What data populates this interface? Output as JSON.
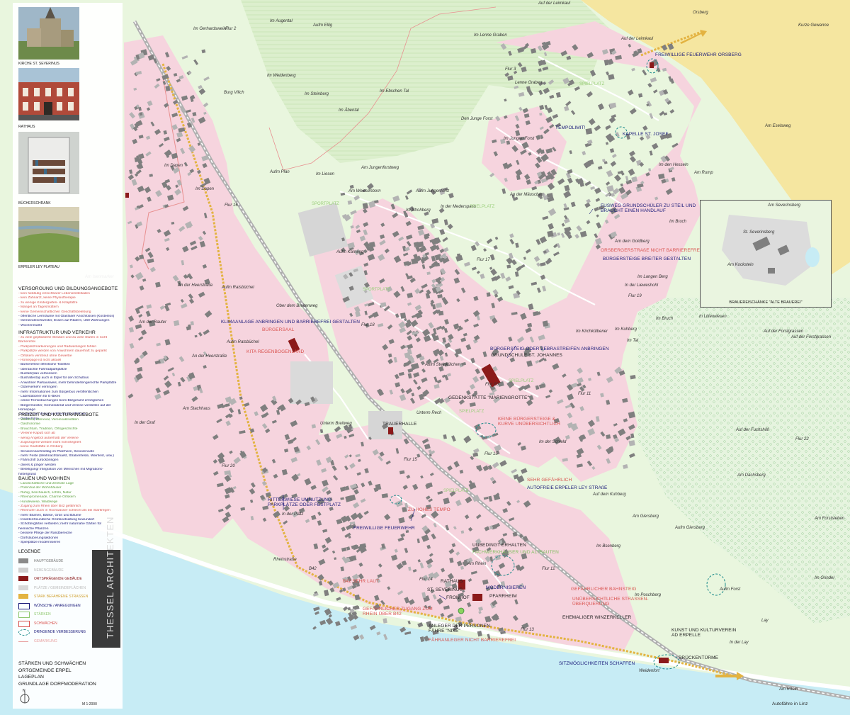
{
  "sidebar": {
    "photos": [
      {
        "caption": "KIRCHE ST. SEVERINUS",
        "color": "#8f8f6a"
      },
      {
        "caption": "RATHAUS",
        "color": "#b04a3a"
      },
      {
        "caption": "BÜCHERSCHRANK",
        "color": "#8a8a82"
      },
      {
        "caption": "ERPELER LEY PLATEAU",
        "color": "#8aa06a"
      }
    ],
    "sections": [
      {
        "title": "VERSORGUNG UND BILDUNGSANGEBOTE",
        "items": [
          {
            "t": "- kein fußläufig erreichbarer Lebensmittelladen",
            "c": "w"
          },
          {
            "t": "- kein Zahnarzt, keine Physiotherapie",
            "c": "w"
          },
          {
            "t": "- zu wenige Kindergarten- & Kitaplätze",
            "c": "w"
          },
          {
            "t": "- Mangel an Tagesmüttern",
            "c": "w"
          },
          {
            "t": "- keine Gemeinschaftlichen Geschäftsbelebung",
            "c": "w"
          },
          {
            "t": "- öffentliche Lernräume mit Glasfaser Anschlüssen (Kostenlos)",
            "c": "v"
          },
          {
            "t": "- Gemeindeschwester, Essen auf Rädern, Ü60 Wohnungen",
            "c": "v"
          },
          {
            "t": "- Wochenmarkt",
            "c": "v"
          }
        ]
      },
      {
        "title": "INFRASTRUKTUR UND VERKEHR",
        "items": [
          {
            "t": "- zu viele gepflasterte Straßen und zu viele Stufen in nicht",
            "c": "w"
          },
          {
            "t": "  Barrierefrei",
            "c": "w"
          },
          {
            "t": "- Parkplatzmarkierungen und Radweitungen fehlen",
            "c": "w"
          },
          {
            "t": "- Parkplätze werden von Anwohnern dauerhaft zu geparkt",
            "c": "w"
          },
          {
            "t": "- Ortskern verstreut ohne Gewerbe",
            "c": "w"
          },
          {
            "t": "- Homepage ist nicht aktuell",
            "c": "w"
          },
          {
            "t": "- Barrierefreie öffentliche Toiletten",
            "c": "v"
          },
          {
            "t": "- überdachte Fahrradparkplätze",
            "c": "v"
          },
          {
            "t": "- Busfahrplan verbessern",
            "c": "v"
          },
          {
            "t": "- Bushaltestop auch in Erpel für den Schulbus",
            "c": "v"
          },
          {
            "t": "- Anwohner Parkausweis, mehr behindertengerechte Parkplätze",
            "c": "v"
          },
          {
            "t": "- Güterverkehr verringern",
            "c": "v"
          },
          {
            "t": "- mehr Informationen zum Bürgerbus veröffentlichen",
            "c": "v"
          },
          {
            "t": "- Ladestationen für E-Bikes",
            "c": "v"
          },
          {
            "t": "- online Terminbuchungen beim Bürgeramt ermöglichen",
            "c": "v"
          },
          {
            "t": "- Bürgermeister, Gemeinderat und Vereine vorstellen auf der",
            "c": "v"
          },
          {
            "t": "  Homepage",
            "c": "v"
          },
          {
            "t": "- kostenloses W-Lan an öffentlichen Plätzen",
            "c": "v"
          },
          {
            "t": "- Gelbe Füße",
            "c": "v"
          }
        ]
      },
      {
        "title": "FREIZEIT UND KULTURANGEBOTE",
        "items": [
          {
            "t": "- Weinfest, Karneval, Vereinsaktivitäten",
            "c": "s"
          },
          {
            "t": "- Gastronomie",
            "c": "s"
          },
          {
            "t": "- Brauchtum, Tradition, Ortsgeschichte",
            "c": "s"
          },
          {
            "t": "- Vereine Kaputt sich ab",
            "c": "w"
          },
          {
            "t": "- wenig Angebot außerhalb der Vereine",
            "c": "w"
          },
          {
            "t": "- Zugezogene werden nicht voll integriert",
            "c": "w"
          },
          {
            "t": "- keine Gaststätte in Orsberg",
            "c": "w"
          },
          {
            "t": "- Seniorennachmittag im Pfarrheim, Seniorencafe",
            "c": "v"
          },
          {
            "t": "- mehr Feste (Weihnachtsmarkt, Straßenfeste, Weinfest, usw.)",
            "c": "v"
          },
          {
            "t": "- Fährschiff zurückbringen",
            "c": "v"
          },
          {
            "t": "- divers & jünger werden",
            "c": "v"
          },
          {
            "t": "- Beteiligung/ Integration von Menschen mit Migrations-",
            "c": "v"
          },
          {
            "t": "  hintergrund",
            "c": "v"
          }
        ]
      },
      {
        "title": "BAUEN UND WOHNEN",
        "items": [
          {
            "t": "- Landschaftliche und Zentrale Lage",
            "c": "s"
          },
          {
            "t": "- Potenzial der Wohnhäuser",
            "c": "s"
          },
          {
            "t": "- Ruhig, beschaulich, schön, Natur",
            "c": "s"
          },
          {
            "t": "- Rheinpromenade, Charme Ortskern",
            "c": "s"
          },
          {
            "t": "- Hundewiese, Waldwege",
            "c": "s"
          },
          {
            "t": "- Zugang zum Rhein über B42 gefährlich",
            "c": "w"
          },
          {
            "t": "- Rheinufer auch in Hochwasser schlecht als bei Starkregen",
            "c": "w"
          },
          {
            "t": "- mehr Blumen, Bänke, Grün und Bäume",
            "c": "v"
          },
          {
            "t": "- Insektenfreundliche Grünbeetsaltung bewundert",
            "c": "v"
          },
          {
            "t": "- Schottergärten verbieten; mehr naturnahe Gärten für",
            "c": "v"
          },
          {
            "t": "  heimische Pflanzen",
            "c": "v"
          },
          {
            "t": "- bessere Pflege der Randbereiche",
            "c": "v"
          },
          {
            "t": "- Dorfsäuberungsaktionen",
            "c": "v"
          },
          {
            "t": "- Spielplätze modernisieren",
            "c": "v"
          }
        ]
      }
    ],
    "legend": {
      "title": "LEGENDE",
      "items": [
        {
          "label": "HAUPTGEBÄUDE",
          "color": "#8a8a8a",
          "kind": "fill",
          "text_color": "#777"
        },
        {
          "label": "NEBENGEBÄUDE",
          "color": "#cfcfcf",
          "kind": "fill",
          "text_color": "#bbb"
        },
        {
          "label": "ORTSPRÄGENDE GEBÄUDE",
          "color": "#8b1a1a",
          "kind": "fill",
          "text_color": "#8b1a1a"
        },
        {
          "label": "PLÄTZE / GEMEINDEFLÄCHEN",
          "color": "#d8d8d8",
          "kind": "fill",
          "text_color": "#bbb"
        },
        {
          "label": "STARK BEFAHRENE STRASSEN",
          "color": "#e3b341",
          "kind": "fill",
          "text_color": "#d0a030"
        },
        {
          "label": "WÜNSCHE / ANREGUNGEN",
          "color": "#1a1a7a",
          "kind": "outline",
          "text_color": "#1a1a7a"
        },
        {
          "label": "STÄRKEN",
          "color": "#8fc86f",
          "kind": "outline",
          "text_color": "#8fc86f"
        },
        {
          "label": "SCHWÄCHEN",
          "color": "#d9534f",
          "kind": "outline",
          "text_color": "#d9534f"
        },
        {
          "label": "DRINGENDE VERBESSERUNG",
          "color": "#1a8a8a",
          "kind": "dash",
          "text_color": "#1a1a7a"
        },
        {
          "label": "GEMARKUNG",
          "color": "#e8a0a0",
          "kind": "line",
          "text_color": "#e8a0a0"
        }
      ]
    },
    "footer_title": [
      "STÄRKEN UND SCHWÄCHEN",
      "ORTGEMEINDE ERPEL",
      "LAGEPLAN",
      "GRUNDLAGE DORFMODERATION"
    ],
    "north": "N",
    "scale": "M 1:2000",
    "brand": "THESSEL ARCHITEKTEN"
  },
  "annotations": [
    {
      "id": "feuerwehr-orsberg",
      "text": "FREIWILLIGE FEUERWEHR ORSBERG",
      "c": "blue"
    },
    {
      "id": "kapelle-josef",
      "text": "KAPELLE ST. JOSEF",
      "c": "blue"
    },
    {
      "id": "tempolimit",
      "text": "TEMPOLIMIT!",
      "c": "blue"
    },
    {
      "id": "fussweg",
      "text": "FUSWEG GRUNDSCHÜLER ZU STEIL UND\nBRAUCHT EINEN HANDLAUF",
      "c": "blue"
    },
    {
      "id": "orsberg-nicht",
      "text": "ORSBERGERSTRAßE NICHT BARRIEREFREI",
      "c": "red"
    },
    {
      "id": "buergersteige-breiter",
      "text": "BÜRGERSTEIGE BREITER GESTALTEN",
      "c": "blue"
    },
    {
      "id": "klima",
      "text": "KLIMAANLAGE ANBRINGEN UND BARRIEREFREI GESTALTEN",
      "c": "blue"
    },
    {
      "id": "buergersaal",
      "text": "BÜRGERSAAL",
      "c": "red"
    },
    {
      "id": "kita",
      "text": "KITA REGENBOGENLAND",
      "c": "red"
    },
    {
      "id": "zebrastreifen",
      "text": "BÜRGERSTEIG ODER ZEBRASTREIFEN ANBRINGEN",
      "c": "blue"
    },
    {
      "id": "grundschule",
      "text": "GRUNDSCHULE ST. JOHANNES",
      "c": "dark"
    },
    {
      "id": "gedenkstaette",
      "text": "GEDENKSTÄTTE \"MARIENGROTTE\"",
      "c": "dark"
    },
    {
      "id": "keine-buergersteige",
      "text": "KEINE BÜRGERSTEIGE &\nKURVE UNÜBERSICHTLICH",
      "c": "red"
    },
    {
      "id": "trauerhalle",
      "text": "TRAUERHALLE",
      "c": "dark"
    },
    {
      "id": "sehr-gefaehrlich",
      "text": "SEHR GEFÄHRLICH",
      "c": "red"
    },
    {
      "id": "autofreie",
      "text": "AUTOFREIE ERPELER LEY STRAßE",
      "c": "blue"
    },
    {
      "id": "ritterwiese",
      "text": "RITTERWIESE UMNUTZUNG\nPARKPLÄTZE ODER FESTPLATZ",
      "c": "blue"
    },
    {
      "id": "zu-hohes-tempo",
      "text": "ZU HOHES TEMPO",
      "c": "red"
    },
    {
      "id": "feuerwehr",
      "text": "FREIWILLIGE FEUERWEHR",
      "c": "blue"
    },
    {
      "id": "unbedingt",
      "text": "UNBEDINGT ERHALTEN",
      "c": "dark"
    },
    {
      "id": "fachwerk",
      "text": "FACHWERKHÄUSER UND ALTBAUTEN",
      "c": "green"
    },
    {
      "id": "b42",
      "text": "B42 SEHR LAUT",
      "c": "red"
    },
    {
      "id": "rathaus",
      "text": "RATHAUS",
      "c": "dark"
    },
    {
      "id": "severinus",
      "text": "ST. SEVERINUS",
      "c": "dark"
    },
    {
      "id": "modernisieren",
      "text": "MODERNISIEREN",
      "c": "blue"
    },
    {
      "id": "pfarrheim",
      "text": "PFARRHEIM",
      "c": "dark"
    },
    {
      "id": "fronhof",
      "text": "FRONHOF",
      "c": "dark"
    },
    {
      "id": "bahnsteig",
      "text": "GEFÄHRLICHER BAHNSTEIG",
      "c": "red"
    },
    {
      "id": "unuebersichtlich",
      "text": "UNÜBERSICHTLICHE STRASSEN-\nÜBERQUERUNG",
      "c": "red"
    },
    {
      "id": "zugang-rhein",
      "text": "GEFÄHRLICHER ZUGANG ZUM\nRHEIN ÜBER B42",
      "c": "red"
    },
    {
      "id": "anleger",
      "text": "ANLEGER DER PERSONEN-\nFÄHRE \"NIXE\"",
      "c": "dark"
    },
    {
      "id": "faehranleger",
      "text": "FÄHRANLEGER NICHT BARRIEREFREI",
      "c": "red"
    },
    {
      "id": "winzerkeller",
      "text": "EHEMALIGER WINZERKELLER",
      "c": "dark"
    },
    {
      "id": "kunst",
      "text": "KUNST UND KULTURVEREIN\nAD ERPELLE",
      "c": "dark"
    },
    {
      "id": "sitzmoeglichkeiten",
      "text": "SITZMÖGLICHKEITEN SCHAFFEN",
      "c": "blue"
    },
    {
      "id": "brueckentuerme",
      "text": "BRÜCKENTÜRME",
      "c": "dark"
    },
    {
      "id": "linz",
      "text": "Autofähre in Linz",
      "c": "dark"
    }
  ],
  "places": [
    {
      "id": "orsberg",
      "text": "Orsberg"
    },
    {
      "id": "leimkaul1",
      "text": "Auf der Leimkaul"
    },
    {
      "id": "leimkaul2",
      "text": "Auf der Leimkaul"
    },
    {
      "id": "kurze",
      "text": "Kurze Gewanne"
    },
    {
      "id": "gerhardsweiler",
      "text": "Im Gerhardsweiler"
    },
    {
      "id": "augental",
      "text": "Im Augental"
    },
    {
      "id": "ellig",
      "text": "Aufm Ellig"
    },
    {
      "id": "lenne",
      "text": "Im Lenne Graben"
    },
    {
      "id": "flur2",
      "text": "Flur 2"
    },
    {
      "id": "flur3",
      "text": "Flur 3"
    },
    {
      "id": "weidenberg",
      "text": "Im Weidenberg"
    },
    {
      "id": "steinberg",
      "text": "Im Steinberg"
    },
    {
      "id": "abental",
      "text": "Im Äbental"
    },
    {
      "id": "ebschen",
      "text": "Im Ebschen Tal"
    },
    {
      "id": "lennegraben",
      "text": "Lenne Graben"
    },
    {
      "id": "jungeforst",
      "text": "Den Junge Forst"
    },
    {
      "id": "jungenforst",
      "text": "Im Jungen Forst"
    },
    {
      "id": "eselsweg",
      "text": "Am Eselsweg"
    },
    {
      "id": "burgvilich",
      "text": "Burg Vilich"
    },
    {
      "id": "dapen",
      "text": "Im Dapen"
    },
    {
      "id": "dapen2",
      "text": "Im Dapen"
    },
    {
      "id": "plan",
      "text": "Aufm Plan"
    },
    {
      "id": "liesen",
      "text": "Im Liesen"
    },
    {
      "id": "jungenforstweg",
      "text": "Am Jungenforstweg"
    },
    {
      "id": "weissenborn",
      "text": "Am Weissenborn"
    },
    {
      "id": "jungenforst2",
      "text": "Aufm Jungenforst"
    },
    {
      "id": "maeuschen",
      "text": "An der Mäuschen"
    },
    {
      "id": "heiseln",
      "text": "Im den Hesseln"
    },
    {
      "id": "rump",
      "text": "Am Rump"
    },
    {
      "id": "flur16",
      "text": "Flur 16"
    },
    {
      "id": "strohberg",
      "text": "Im Strohberg"
    },
    {
      "id": "mederspass",
      "text": "In der Mederspass"
    },
    {
      "id": "bruch",
      "text": "Im Bruch"
    },
    {
      "id": "goldberg",
      "text": "Am dem Goldberg"
    },
    {
      "id": "karrweg",
      "text": "Aufm Karrweg"
    },
    {
      "id": "flur17",
      "text": "Flur 17"
    },
    {
      "id": "langenberg",
      "text": "Im Langen Berg"
    },
    {
      "id": "lieweshohl",
      "text": "In der Lieweshohl"
    },
    {
      "id": "isenmarker",
      "text": "Am Isenmarker"
    },
    {
      "id": "heerstrasse",
      "text": "An der Heerstraße"
    },
    {
      "id": "rabuechel",
      "text": "Aufm Ratsbüchel"
    },
    {
      "id": "breitenweg",
      "text": "Ober dem Breitenweg"
    },
    {
      "id": "flur18",
      "text": "Flur 18"
    },
    {
      "id": "rabuechel2",
      "text": "Aufm Ratsbüchel"
    },
    {
      "id": "rauter",
      "text": "Am der Rauter"
    },
    {
      "id": "heerstrasse2",
      "text": "An der Heerstraße"
    },
    {
      "id": "flur15",
      "text": "Flur 15"
    },
    {
      "id": "flur19",
      "text": "Flur 19"
    },
    {
      "id": "kirchkuehl",
      "text": "Im Kirchkülbener"
    },
    {
      "id": "kuhberg",
      "text": "Im Kuhberg"
    },
    {
      "id": "tal",
      "text": "Im Tal"
    },
    {
      "id": "bruch2",
      "text": "Im Bruch"
    },
    {
      "id": "litterwiesen",
      "text": "In Litterwiesen"
    },
    {
      "id": "forstgrassen",
      "text": "Auf der Forstgrassen"
    },
    {
      "id": "forstgrassen2",
      "text": "Auf der Forstgrassen"
    },
    {
      "id": "steinkuehl",
      "text": "Aufm Steinkülchen"
    },
    {
      "id": "flur10",
      "text": "Flur 10"
    },
    {
      "id": "flur11",
      "text": "Flur 11"
    },
    {
      "id": "stachhaus",
      "text": "Am Stachhaus"
    },
    {
      "id": "graf",
      "text": "In der Graf"
    },
    {
      "id": "breitweg",
      "text": "Unterm Breitweg"
    },
    {
      "id": "unterrech",
      "text": "Unterm Rech"
    },
    {
      "id": "schield",
      "text": "Im der Schield"
    },
    {
      "id": "fuchshoehl",
      "text": "Auf der Fuchshöll"
    },
    {
      "id": "flur22",
      "text": "Flur 22"
    },
    {
      "id": "dachsberg",
      "text": "Am Dachsberg"
    },
    {
      "id": "kuhberg2",
      "text": "Auf dem Kuhberg"
    },
    {
      "id": "giersberg",
      "text": "Am Giersberg"
    },
    {
      "id": "flur20",
      "text": "Flur 20"
    },
    {
      "id": "flur15b",
      "text": "Flur 15"
    },
    {
      "id": "plaetz",
      "text": "In der Plätz"
    },
    {
      "id": "flur14",
      "text": "Flur 14"
    },
    {
      "id": "flur12",
      "text": "Flur 12"
    },
    {
      "id": "flur13",
      "text": "Flur 13"
    },
    {
      "id": "giersberg2",
      "text": "Aufm Giersberg"
    },
    {
      "id": "forstsieben",
      "text": "Am Forstsieben"
    },
    {
      "id": "grindel",
      "text": "Im Grindel"
    },
    {
      "id": "poschberg",
      "text": "Im Poschberg"
    },
    {
      "id": "forst",
      "text": "Aufm Forst"
    },
    {
      "id": "lay",
      "text": "Lay"
    },
    {
      "id": "inderlay",
      "text": "In der Lay"
    },
    {
      "id": "weidenfort",
      "text": "Weidenfort"
    },
    {
      "id": "amrhein",
      "text": "Am Rhein"
    },
    {
      "id": "bsenberg",
      "text": "Im Bsenberg"
    },
    {
      "id": "rheinstrasse",
      "text": "Rheinstraße"
    },
    {
      "id": "rheinweg",
      "text": "Am Rhein"
    },
    {
      "id": "sportplatz1",
      "text": "SPORTPLATZ"
    },
    {
      "id": "sportplatz2",
      "text": "SPORTPLATZ"
    },
    {
      "id": "spielplatz1",
      "text": "SPIELPLATZ"
    },
    {
      "id": "spielplatz2",
      "text": "SPIELPLATZ"
    },
    {
      "id": "spielplatz3",
      "text": "SPIELPLATZ"
    },
    {
      "id": "spielplatz4",
      "text": "SPIELPLATZ"
    },
    {
      "id": "spielplatz5",
      "text": "SPIELPLATZ"
    },
    {
      "id": "b42tag",
      "text": "B42"
    }
  ],
  "inset": {
    "caption": "BRAUEREISCHÄNKE \"ALTE BRAUEREI\"",
    "labels": [
      "Am Severinsberg",
      "St. Severinsberg",
      "Am Kockstein"
    ]
  },
  "colors": {
    "settlement": "#f6d4de",
    "meadow": "#e4f3d8",
    "field": "#d3ecc2",
    "vineyard": "#cbe8b8",
    "water": "#c7ecf5",
    "yellow_field": "#f5e6a0",
    "building": "#7f7f7f",
    "landmark": "#8b1a1a",
    "road_main": "#e3b341"
  }
}
